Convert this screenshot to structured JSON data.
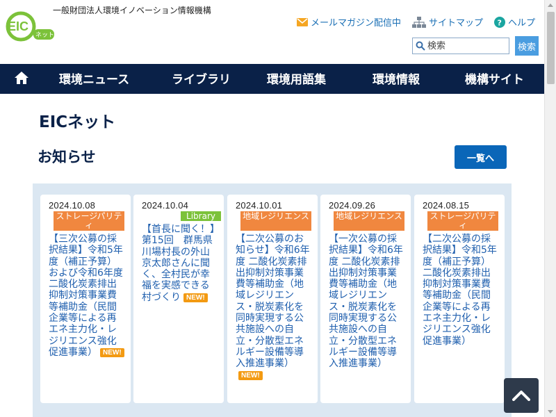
{
  "header": {
    "logo_text": "EIC",
    "logo_sub": "ネット",
    "org_name": "一般財団法人環境イノベーション情報機構",
    "utility": {
      "mail": "メールマガジン配信中",
      "sitemap": "サイトマップ",
      "help": "ヘルプ"
    },
    "search": {
      "placeholder": "検索",
      "button": "検索"
    }
  },
  "nav": {
    "items": [
      {
        "label": "環境ニュース"
      },
      {
        "label": "ライブラリ"
      },
      {
        "label": "環境用語集"
      },
      {
        "label": "環境情報"
      },
      {
        "label": "機構サイト"
      }
    ]
  },
  "main": {
    "site_title": "EICネット",
    "section_title": "お知らせ",
    "list_button": "一覧へ",
    "cards": [
      {
        "date": "2024.10.08",
        "tag": "ストレージパリティ",
        "tag_color": "#f0873f",
        "text": "【三次公募の採択結果】令和5年度（補正予算）および令和6年度二酸化炭素排出抑制対策事業費等補助金（民間企業等による再エネ主力化・レジリエンス強化促進事業）",
        "badge": "NEW!"
      },
      {
        "date": "2024.10.04",
        "tag": "Library",
        "tag_color": "#7cc23a",
        "text": "【首長に聞く！】第15回　群馬県川場村長の外山京太郎さんに聞く、全村民が幸福を実感できる村づくり",
        "badge": "NEW!"
      },
      {
        "date": "2024.10.01",
        "tag": "地域レジリエンス",
        "tag_color": "#f0873f",
        "text": "【二次公募のお知らせ】令和6年度 二酸化炭素排出抑制対策事業費等補助金（地域レジリエンス・脱炭素化を同時実現する公共施設への自立・分散型エネルギー設備等導入推進事業）",
        "badge": "NEW!"
      },
      {
        "date": "2024.09.26",
        "tag": "地域レジリエンス",
        "tag_color": "#f0873f",
        "text": "【一次公募の採択結果】令和6年度 二酸化炭素排出抑制対策事業費等補助金（地域レジリエンス・脱炭素化を同時実現する公共施設への自立・分散型エネルギー設備等導入推進事業）",
        "badge": ""
      },
      {
        "date": "2024.08.15",
        "tag": "ストレージパリティ",
        "tag_color": "#f0873f",
        "text": "【二次公募の採択結果】令和5年度（補正予算）二酸化炭素排出抑制対策事業費等補助金（民間企業等による再エネ主力化・レジリエンス強化促進事業）",
        "badge": ""
      }
    ]
  },
  "colors": {
    "nav_bg": "#0a2148",
    "link": "#1f5fae",
    "accent_orange": "#f0873f",
    "accent_green": "#7cc23a",
    "new_badge": "#f39a12",
    "panel_bg": "#dbe7f2"
  }
}
